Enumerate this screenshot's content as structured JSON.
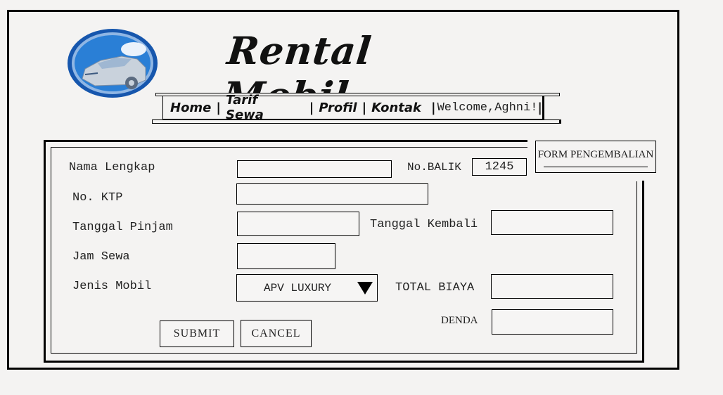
{
  "header": {
    "title": "Rental Mobil",
    "logo_icon": "car-logo-icon",
    "nav": [
      {
        "label": "Home"
      },
      {
        "label": "Tarif Sewa"
      },
      {
        "label": "Profil"
      },
      {
        "label": "Kontak"
      }
    ],
    "separator": "|",
    "welcome": "Welcome,Aghni!",
    "welcome_bar": "|"
  },
  "form": {
    "title": "FORM PENGEMBALIAN",
    "fields": {
      "nama_lengkap": {
        "label": "Nama Lengkap",
        "value": ""
      },
      "no_balik": {
        "label": "No.BALIK",
        "value": "1245"
      },
      "no_ktp": {
        "label": "No. KTP",
        "value": ""
      },
      "tanggal_pinjam": {
        "label": "Tanggal Pinjam",
        "value": ""
      },
      "tanggal_kembali": {
        "label": "Tanggal Kembali",
        "value": ""
      },
      "jam_sewa": {
        "label": "Jam Sewa",
        "value": ""
      },
      "jenis_mobil": {
        "label": "Jenis Mobil",
        "value": "APV LUXURY"
      },
      "total_biaya": {
        "label": "TOTAL BIAYA",
        "value": ""
      },
      "denda": {
        "label": "DENDA",
        "value": ""
      }
    },
    "buttons": {
      "submit": "SUBMIT",
      "cancel": "CANCEL"
    }
  },
  "colors": {
    "background": "#f4f3f2",
    "border": "#000000",
    "logo_blue": "#1e6fc4",
    "logo_dark_blue": "#0f4fa0"
  }
}
